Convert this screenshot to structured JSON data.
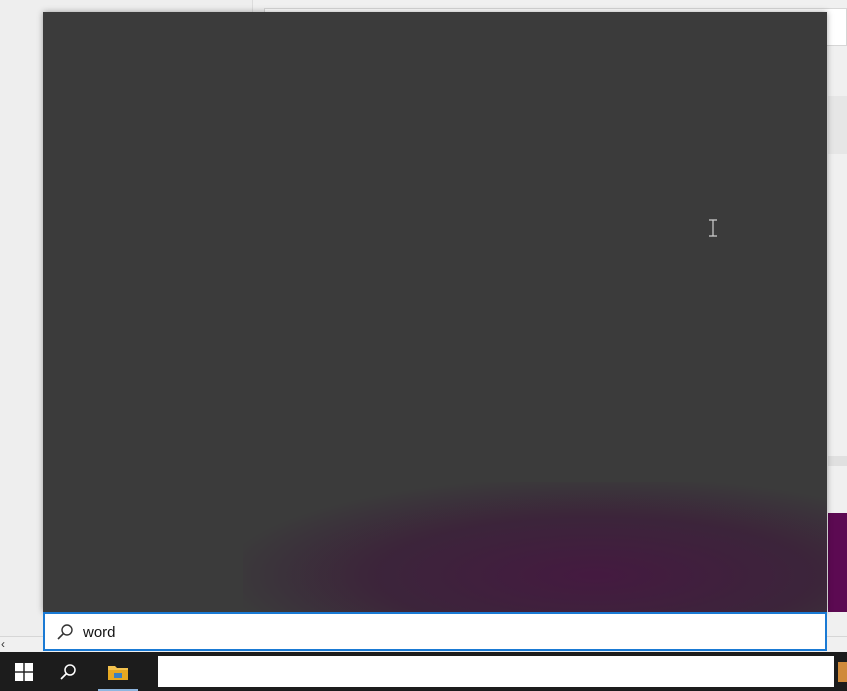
{
  "search": {
    "value": "word",
    "placeholder": ""
  },
  "taskbar": {
    "items": [
      {
        "icon": "windows-start-icon"
      },
      {
        "icon": "search-icon"
      },
      {
        "icon": "file-explorer-icon"
      }
    ]
  },
  "colors": {
    "flyout_bg": "#3b3b3b",
    "accent": "#1a7ad4",
    "taskbar_bg": "#1c1c1c",
    "purple": "#5c0a52"
  }
}
